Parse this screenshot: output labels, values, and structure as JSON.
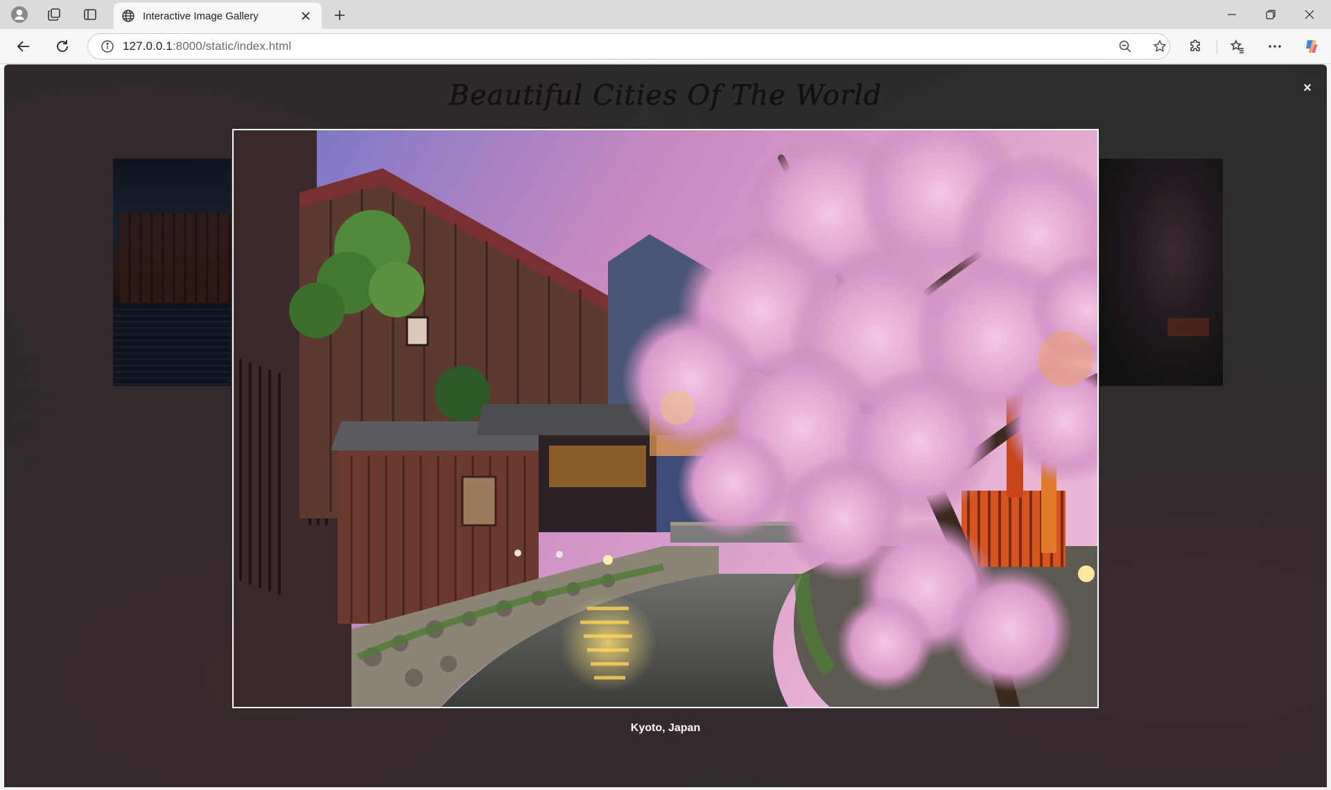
{
  "browser": {
    "tab_title": "Interactive Image Gallery",
    "url_host": "127.0.0.1",
    "url_rest": ":8000/static/index.html"
  },
  "gallery": {
    "title": "Beautiful Cities Of The World",
    "close_symbol": "×",
    "caption": "Kyoto, Japan"
  },
  "icons": {
    "profile": "profile-icon",
    "workspaces": "workspaces-icon",
    "tab_actions": "tab-actions-icon",
    "globe": "globe-icon",
    "close": "close-icon",
    "plus": "plus-icon",
    "back": "back-arrow-icon",
    "refresh": "refresh-icon",
    "info": "info-icon",
    "zoom": "zoom-out-icon",
    "star": "star-icon",
    "extensions": "extensions-icon",
    "favorites": "favorites-icon",
    "more": "more-icon",
    "copilot": "copilot-icon"
  },
  "colors": {
    "page_background": "#2b2b2c",
    "frame_border": "#ffffff",
    "caption_text": "#ffffff",
    "title_text": "#111111"
  }
}
